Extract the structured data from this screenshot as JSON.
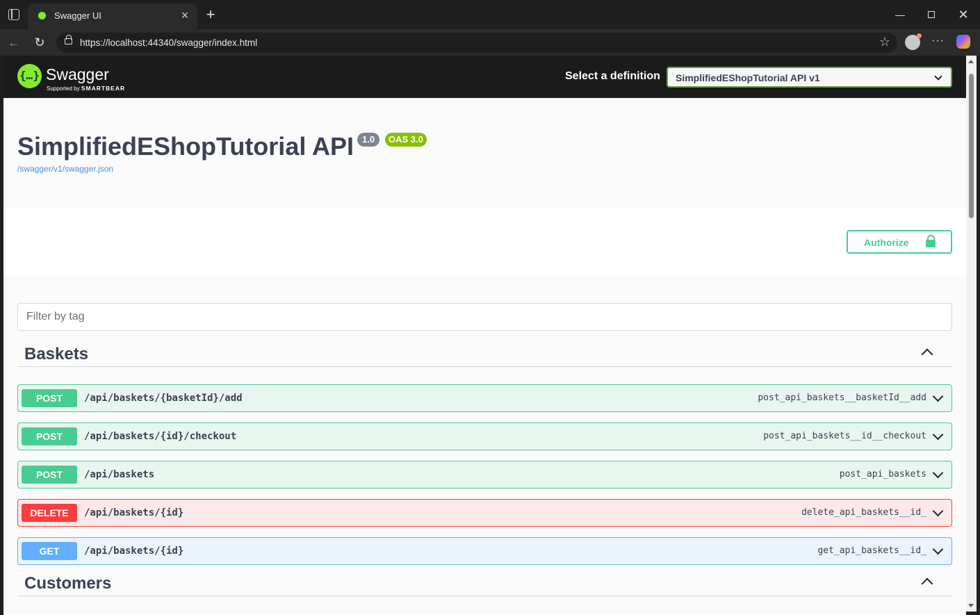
{
  "browser": {
    "tab_title": "Swagger UI",
    "url": "https://localhost:44340/swagger/index.html"
  },
  "topbar": {
    "logo_text": "Swagger",
    "logo_sub_prefix": "Supported by",
    "logo_sub_brand": "SMARTBEAR",
    "definition_label": "Select a definition",
    "definition_value": "SimplifiedEShopTutorial API v1"
  },
  "info": {
    "title": "SimplifiedEShopTutorial API",
    "version": "1.0",
    "oas": "OAS 3.0",
    "spec_link": "/swagger/v1/swagger.json"
  },
  "authorize": {
    "label": "Authorize"
  },
  "filter": {
    "placeholder": "Filter by tag"
  },
  "tags": [
    {
      "name": "Baskets",
      "operations": [
        {
          "method": "POST",
          "path": "/api/baskets/{basketId}/add",
          "operation_id": "post_api_baskets__basketId__add"
        },
        {
          "method": "POST",
          "path": "/api/baskets/{id}/checkout",
          "operation_id": "post_api_baskets__id__checkout"
        },
        {
          "method": "POST",
          "path": "/api/baskets",
          "operation_id": "post_api_baskets"
        },
        {
          "method": "DELETE",
          "path": "/api/baskets/{id}",
          "operation_id": "delete_api_baskets__id_"
        },
        {
          "method": "GET",
          "path": "/api/baskets/{id}",
          "operation_id": "get_api_baskets__id_"
        }
      ]
    },
    {
      "name": "Customers",
      "operations": []
    }
  ],
  "colors": {
    "post": "#49cc90",
    "delete": "#f93e3e",
    "get": "#61affe",
    "swagger_green": "#85ea2d"
  }
}
